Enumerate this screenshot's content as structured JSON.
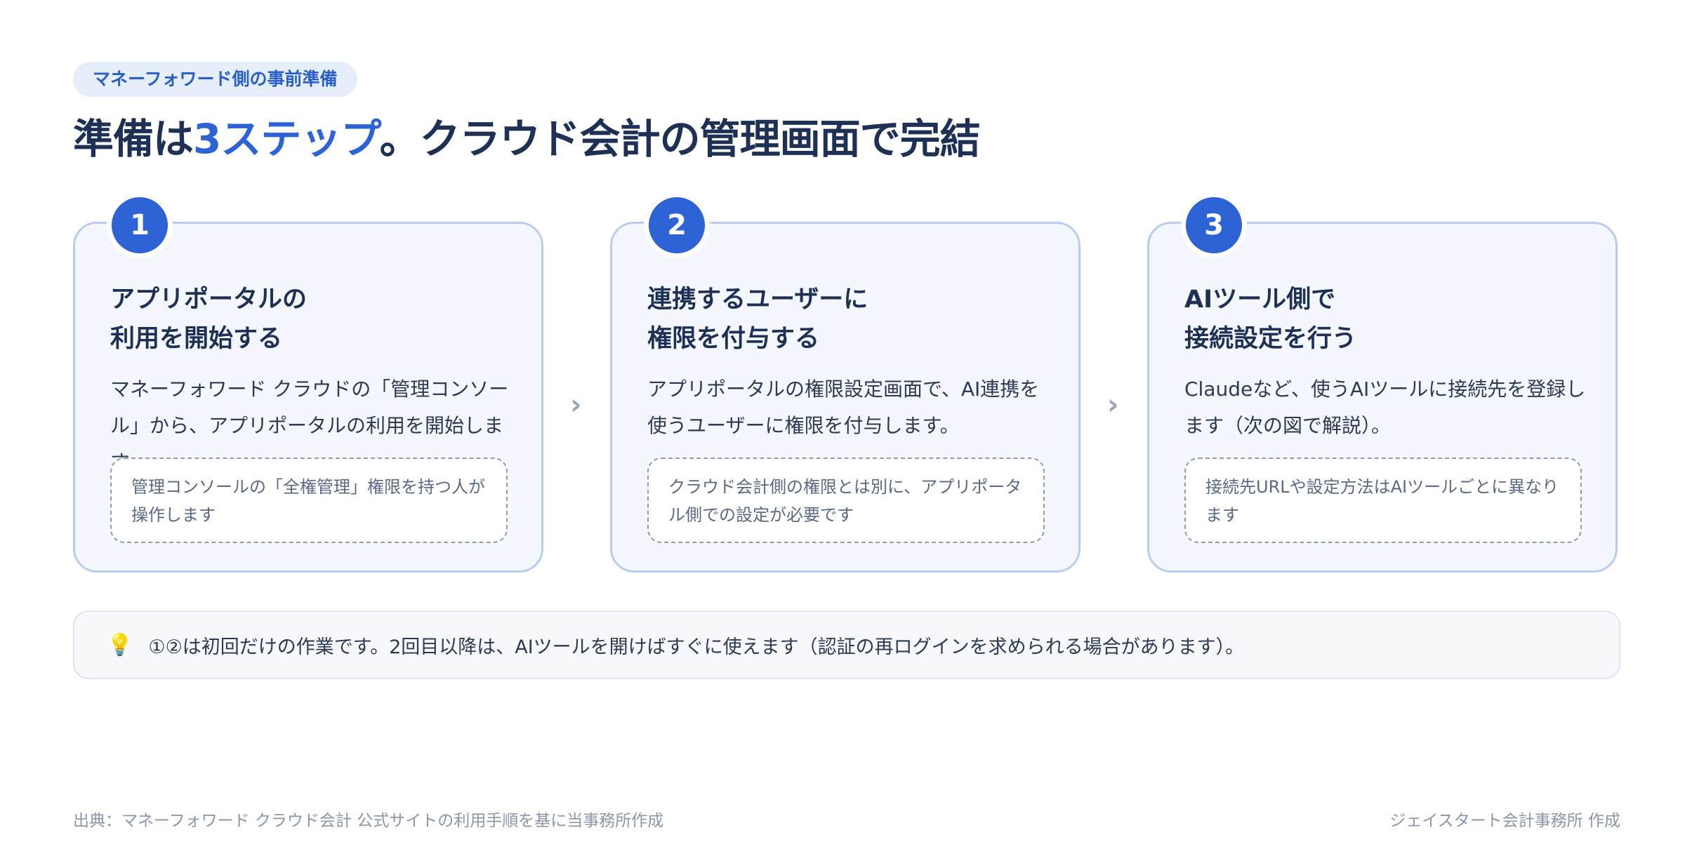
{
  "header": {
    "tag": "マネーフォワード側の事前準備",
    "headline_pre": "準備は",
    "headline_accent": "3ステップ",
    "headline_post": "。クラウド会計の管理画面で完結"
  },
  "steps": [
    {
      "number": "1",
      "title_line1": "アプリポータルの",
      "title_line2": "利用を開始する",
      "description": "マネーフォワード クラウドの「管理コンソール」から、アプリポータルの利用を開始します。",
      "note": "管理コンソールの「全権管理」権限を持つ人が操作します"
    },
    {
      "number": "2",
      "title_line1": "連携するユーザーに",
      "title_line2": "権限を付与する",
      "description": "アプリポータルの権限設定画面で、AI連携を使うユーザーに権限を付与します。",
      "note": "クラウド会計側の権限とは別に、アプリポータル側での設定が必要です"
    },
    {
      "number": "3",
      "title_line1": "AIツール側で",
      "title_line2": "接続設定を行う",
      "description": "Claudeなど、使うAIツールに接続先を登録します（次の図で解説）。",
      "note": "接続先URLや設定方法はAIツールごとに異なります"
    }
  ],
  "arrows": [
    "›",
    "›"
  ],
  "tip": {
    "icon": "lightbulb-icon",
    "text": "①②は初回だけの作業です。2回目以降は、AIツールを開けばすぐに使えます（認証の再ログインを求められる場合があります）。"
  },
  "footer": {
    "source": "出典：マネーフォワード クラウド会計 公式サイトの利用手順を基に当事務所作成",
    "credit": "ジェイスタート会計事務所 作成"
  },
  "colors": {
    "accent": "#2d63d4",
    "title": "#1e3054",
    "card_bg": "#f4f7fd",
    "card_border": "#b9cdee"
  }
}
